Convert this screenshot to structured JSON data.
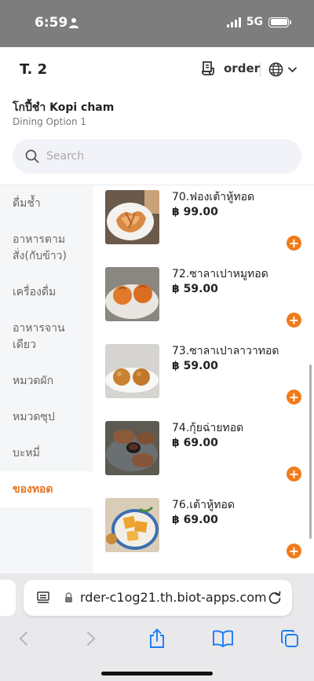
{
  "status_bar": {
    "time": "6:59",
    "network": "5G"
  },
  "header": {
    "table": "T. 2",
    "order_label": "order"
  },
  "store": {
    "name": "โกปี้ชำ Kopi cham",
    "dining_option": "Dining Option 1"
  },
  "search": {
    "placeholder": "Search"
  },
  "sidebar": {
    "items": [
      {
        "label": "ดื่มช้ำ"
      },
      {
        "label": "อาหารตามสั่ง(กับข้าว)"
      },
      {
        "label": "เครื่องดื่ม"
      },
      {
        "label": "อาหารจานเดียว"
      },
      {
        "label": "หมวดผัก"
      },
      {
        "label": "หมวดซุป"
      },
      {
        "label": "บะหมี่"
      },
      {
        "label": "ของทอด"
      }
    ],
    "active_index": 7
  },
  "products": [
    {
      "name": "70.ฟองเต้าหู้ทอด",
      "price": "฿ 99.00"
    },
    {
      "name": "72.ซาลาเปาหมูทอด",
      "price": "฿ 59.00"
    },
    {
      "name": "73.ซาลาเปาลาวาทอด",
      "price": "฿ 59.00"
    },
    {
      "name": "74.กุ้ยฉ่ายทอด",
      "price": "฿ 69.00"
    },
    {
      "name": "76.เต้าหู้ทอด",
      "price": "฿ 69.00"
    }
  ],
  "browser": {
    "url": "rder-c1og21.th.biot-apps.com"
  },
  "colors": {
    "accent": "#f07b1a",
    "status_bar": "#7d7d7d"
  }
}
